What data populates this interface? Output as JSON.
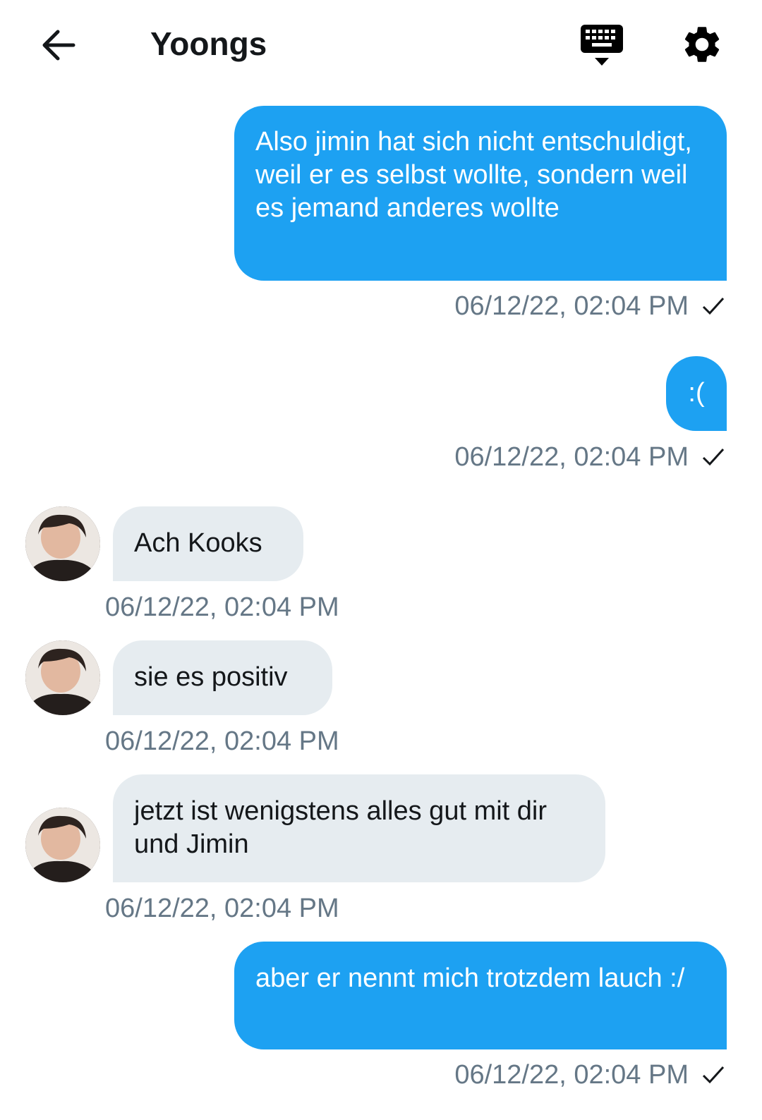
{
  "header": {
    "title": "Yoongs",
    "icons": {
      "back": "arrow-left-icon",
      "keyboard": "keyboard-icon",
      "settings": "gear-icon"
    }
  },
  "colors": {
    "outgoing_bubble": "#1da1f2",
    "incoming_bubble": "#e6ecf0",
    "timestamp": "#657786"
  },
  "messages": [
    {
      "direction": "out",
      "text": "Also jimin hat sich nicht entschuldigt, weil er es selbst wollte, sondern weil es jemand anderes wollte",
      "timestamp": "06/12/22, 02:04 PM",
      "status": "sent-check-icon"
    },
    {
      "direction": "out",
      "text": ":(",
      "timestamp": "06/12/22, 02:04 PM",
      "status": "sent-check-icon"
    },
    {
      "direction": "in",
      "text": "Ach Kooks",
      "timestamp": "06/12/22, 02:04 PM"
    },
    {
      "direction": "in",
      "text": "sie es positiv",
      "timestamp": "06/12/22, 02:04 PM"
    },
    {
      "direction": "in",
      "text": "jetzt ist wenigstens alles gut mit dir und Jimin",
      "timestamp": "06/12/22, 02:04 PM"
    },
    {
      "direction": "out",
      "text": "aber er nennt mich trotzdem lauch :/",
      "timestamp": "06/12/22, 02:04 PM",
      "status": "sent-check-icon"
    }
  ]
}
